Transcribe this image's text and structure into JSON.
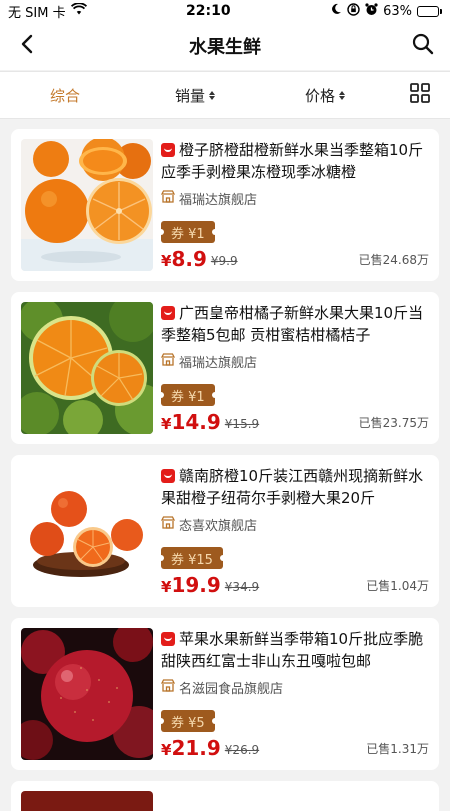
{
  "status": {
    "carrier": "无 SIM 卡",
    "time": "22:10",
    "battery": "63%",
    "battery_level": 0.63
  },
  "header": {
    "title": "水果生鲜"
  },
  "sort": {
    "items": [
      {
        "label": "综合",
        "active": true
      },
      {
        "label": "销量"
      },
      {
        "label": "价格"
      }
    ]
  },
  "products": [
    {
      "title": "橙子脐橙甜橙新鲜水果当季整箱10斤应季手剥橙果冻橙现季冰糖橙",
      "shop": "福瑞达旗舰店",
      "coupon": "券 ¥1",
      "yen": "¥",
      "price": "8.9",
      "orig": "¥9.9",
      "sold": "已售24.68万",
      "image": "oranges"
    },
    {
      "title": "广西皇帝柑橘子新鲜水果大果10斤当季整箱5包邮 贡柑蜜桔柑橘桔子",
      "shop": "福瑞达旗舰店",
      "coupon": "券 ¥1",
      "yen": "¥",
      "price": "14.9",
      "orig": "¥15.9",
      "sold": "已售23.75万",
      "image": "green-tangerines"
    },
    {
      "title": "赣南脐橙10斤装江西赣州现摘新鲜水果甜橙子纽荷尔手剥橙大果20斤",
      "shop": "态喜欢旗舰店",
      "coupon": "券 ¥15",
      "yen": "¥",
      "price": "19.9",
      "orig": "¥34.9",
      "sold": "已售1.04万",
      "image": "navel-oranges"
    },
    {
      "title": "苹果水果新鲜当季带箱10斤批应季脆甜陕西红富士非山东丑嘎啦包邮",
      "shop": "名滋园食品旗舰店",
      "coupon": "券 ¥5",
      "yen": "¥",
      "price": "21.9",
      "orig": "¥26.9",
      "sold": "已售1.31万",
      "image": "red-apples"
    }
  ]
}
